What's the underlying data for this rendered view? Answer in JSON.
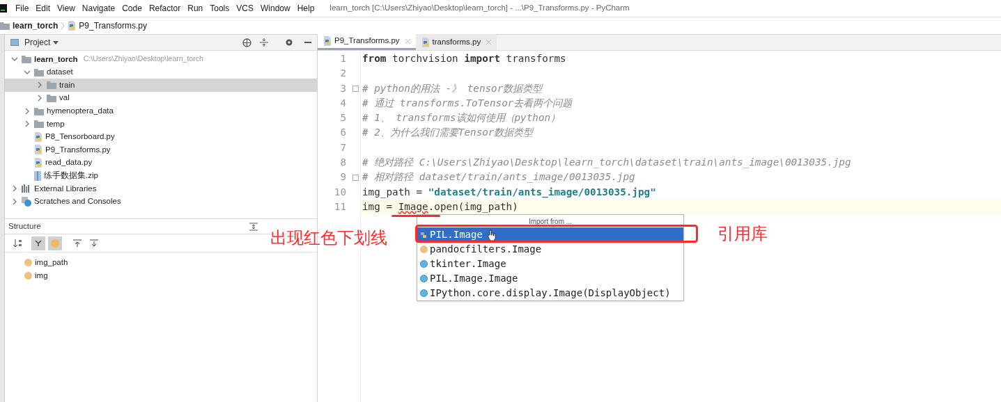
{
  "menu": [
    "File",
    "Edit",
    "View",
    "Navigate",
    "Code",
    "Refactor",
    "Run",
    "Tools",
    "VCS",
    "Window",
    "Help"
  ],
  "window": {
    "title": "learn_torch [C:\\Users\\Zhiyao\\Desktop\\learn_torch] - ...\\P9_Transforms.py - PyCharm"
  },
  "breadcrumb": [
    "learn_torch",
    "P9_Transforms.py"
  ],
  "project": {
    "title": "Project",
    "tree": [
      {
        "label": "learn_torch",
        "path": "C:\\Users\\Zhiyao\\Desktop\\learn_torch",
        "kind": "folder",
        "expanded": true,
        "selected": false,
        "children": [
          {
            "label": "dataset",
            "kind": "folder",
            "expanded": true,
            "selected": false,
            "children": [
              {
                "label": "train",
                "kind": "folder",
                "expanded": false,
                "selected": true
              },
              {
                "label": "val",
                "kind": "folder",
                "expanded": false,
                "selected": false
              }
            ]
          },
          {
            "label": "hymenoptera_data",
            "kind": "folder",
            "expanded": false,
            "selected": false
          },
          {
            "label": "temp",
            "kind": "folder",
            "expanded": false,
            "selected": false
          },
          {
            "label": "P8_Tensorboard.py",
            "kind": "python",
            "selected": false
          },
          {
            "label": "P9_Transforms.py",
            "kind": "python",
            "selected": false
          },
          {
            "label": "read_data.py",
            "kind": "python",
            "selected": false
          },
          {
            "label": "练手数据集.zip",
            "kind": "zip",
            "selected": false
          }
        ]
      },
      {
        "label": "External Libraries",
        "kind": "library",
        "expanded": false,
        "selected": false
      },
      {
        "label": "Scratches and Consoles",
        "kind": "scratches",
        "expanded": false,
        "selected": false
      }
    ]
  },
  "structure": {
    "title": "Structure",
    "items": [
      "img_path",
      "img"
    ]
  },
  "tabs": [
    {
      "label": "P9_Transforms.py",
      "selected": true
    },
    {
      "label": "transforms.py",
      "selected": false
    }
  ],
  "code": [
    {
      "n": "1",
      "current": false,
      "tokens": [
        {
          "kind": "keyword",
          "text": "from"
        },
        {
          "kind": "plain",
          "text": " torchvision "
        },
        {
          "kind": "keyword",
          "text": "import"
        },
        {
          "kind": "plain",
          "text": " transforms"
        }
      ]
    },
    {
      "n": "2",
      "current": false
    },
    {
      "n": "3",
      "current": false,
      "fold": true,
      "tokens": [
        {
          "kind": "comment",
          "text": "# python的用法 -》 tensor数据类型"
        }
      ]
    },
    {
      "n": "4",
      "current": false,
      "tokens": [
        {
          "kind": "comment",
          "text": "# 通过 transforms.ToTensor去看两个问题"
        }
      ]
    },
    {
      "n": "5",
      "current": false,
      "tokens": [
        {
          "kind": "comment",
          "text": "# 1、 transforms该如何使用（python）"
        }
      ]
    },
    {
      "n": "6",
      "current": false,
      "tokens": [
        {
          "kind": "comment",
          "text": "# 2、为什么我们需要Tensor数据类型"
        }
      ]
    },
    {
      "n": "7",
      "current": false
    },
    {
      "n": "8",
      "current": false,
      "tokens": [
        {
          "kind": "comment",
          "text": "# 绝对路径 C:\\Users\\Zhiyao\\Desktop\\learn_torch\\dataset\\train\\ants_image\\0013035.jpg"
        }
      ]
    },
    {
      "n": "9",
      "current": false,
      "fold": true,
      "tokens": [
        {
          "kind": "comment",
          "text": "# 相对路径 dataset/train/ants_image/0013035.jpg"
        }
      ]
    },
    {
      "n": "10",
      "current": false,
      "tokens": [
        {
          "kind": "plain",
          "text": "img_path = "
        },
        {
          "kind": "string",
          "text": "\"dataset/train/ants_image/0013035.jpg\""
        }
      ]
    },
    {
      "n": "11",
      "current": true,
      "tokens": [
        {
          "kind": "plain",
          "text": "img = "
        },
        {
          "kind": "error",
          "text": "Image"
        },
        {
          "kind": "plain",
          "text": ".open(img_path)"
        }
      ]
    }
  ],
  "popup": {
    "header": "Import from ...",
    "items": [
      {
        "label": "PIL.Image",
        "kind": "module",
        "selected": true
      },
      {
        "label": "pandocfilters.Image",
        "kind": "variable",
        "selected": false
      },
      {
        "label": "tkinter.Image",
        "kind": "class",
        "selected": false
      },
      {
        "label": "PIL.Image.Image",
        "kind": "class",
        "selected": false
      },
      {
        "label": "IPython.core.display.Image(DisplayObject)",
        "kind": "class",
        "selected": false
      }
    ]
  },
  "annotations": [
    {
      "text": "出现红色下划线",
      "color": "#ff2a2a"
    },
    {
      "text": "引用库",
      "color": "#ff2a2a"
    }
  ]
}
